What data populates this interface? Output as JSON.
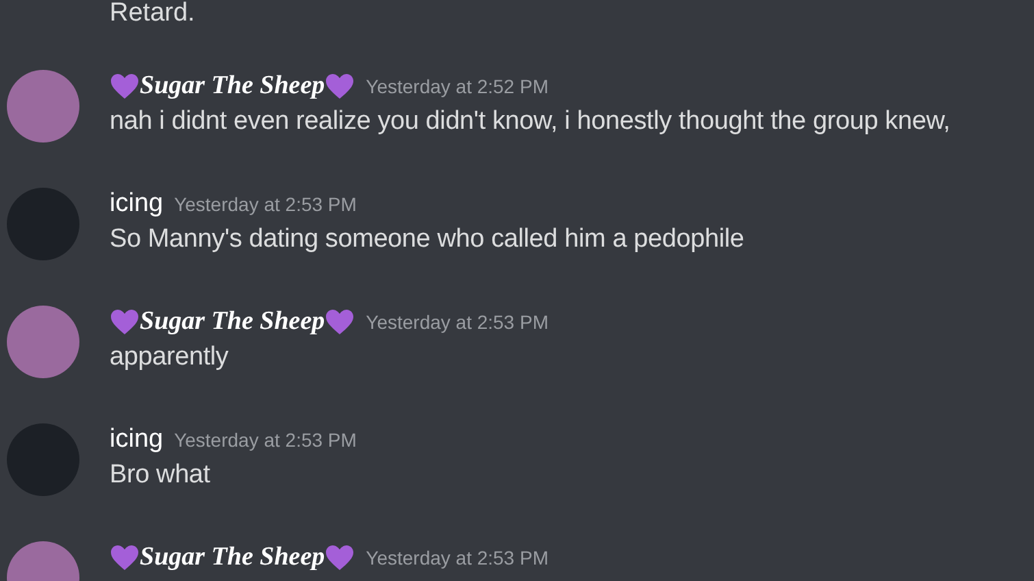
{
  "chat": {
    "partial_text": "Retard.",
    "messages": [
      {
        "author": "Sugar The Sheep",
        "hearts": true,
        "color": "#9a6a9e",
        "time": "Yesterday at 2:52 PM",
        "text": "nah i didnt even realize you didn't know, i honestly thought the group knew,"
      },
      {
        "author": "icing",
        "hearts": false,
        "color": "#1c2026",
        "time": "Yesterday at 2:53 PM",
        "text": "So Manny's dating someone who called him a pedophile"
      },
      {
        "author": "Sugar The Sheep",
        "hearts": true,
        "color": "#9a6a9e",
        "time": "Yesterday at 2:53 PM",
        "text": "apparently"
      },
      {
        "author": "icing",
        "hearts": false,
        "color": "#1c2026",
        "time": "Yesterday at 2:53 PM",
        "text": "Bro what"
      },
      {
        "author": "Sugar The Sheep",
        "hearts": true,
        "color": "#9a6a9e",
        "time": "Yesterday at 2:53 PM"
      }
    ]
  }
}
